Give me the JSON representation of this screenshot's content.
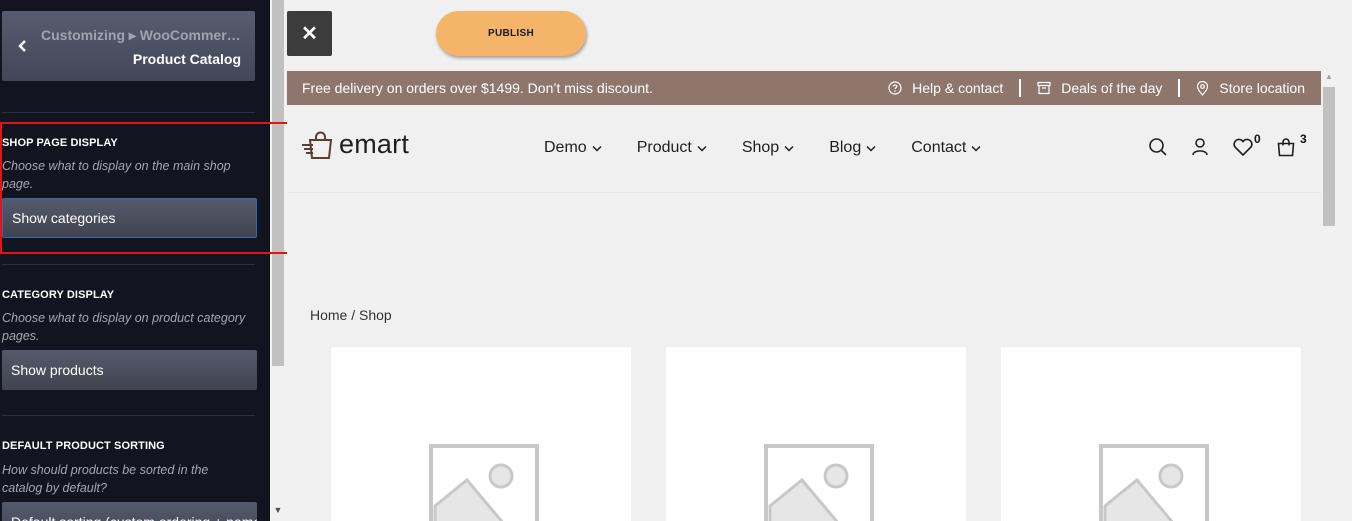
{
  "sidebar": {
    "back_icon": "chevron-left-icon",
    "breadcrumb": "Customizing ▸ WooCommerce",
    "title": "Product Catalog",
    "sections": [
      {
        "title": "Shop page display",
        "desc": "Choose what to display on the main shop page.",
        "value": "Show categories"
      },
      {
        "title": "Category display",
        "desc": "Choose what to display on product category pages.",
        "value": "Show products"
      },
      {
        "title": "Default product sorting",
        "desc": "How should products be sorted in the catalog by default?",
        "value": "Default sorting (custom ordering + name)"
      }
    ]
  },
  "controls": {
    "close_label": "✕",
    "publish_label": "PUBLISH"
  },
  "preview": {
    "topbar": {
      "promo": "Free delivery on orders over $1499. Don’t miss discount.",
      "links": [
        "Help & contact",
        "Deals of the day",
        "Store location"
      ]
    },
    "logo_text": "emart",
    "menu": [
      "Demo",
      "Product",
      "Shop",
      "Blog",
      "Contact"
    ],
    "wishlist_count": "0",
    "cart_count": "3",
    "breadcrumb": "Home / Shop"
  },
  "colors": {
    "sidebar_bg": "#12141f",
    "topbar_bg": "#8f766d",
    "publish_bg": "#f4b56b",
    "highlight": "#e01515"
  }
}
